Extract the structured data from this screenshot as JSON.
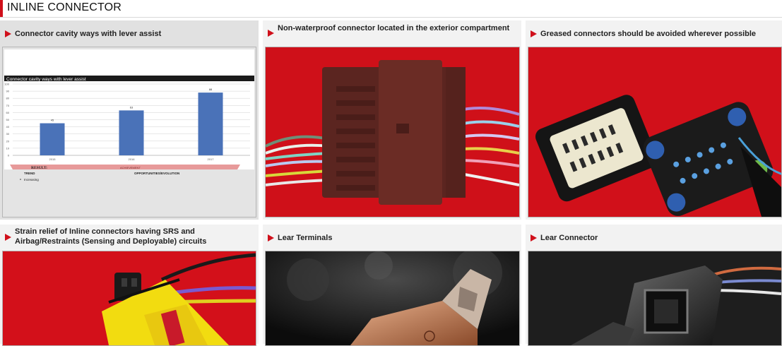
{
  "page": {
    "title": "INLINE CONNECTOR"
  },
  "cards": [
    {
      "title": "Connector cavity ways with lever assist",
      "image": "bar-chart-slide"
    },
    {
      "title": "Non-waterproof connector located in the exterior compartment",
      "image": "brown-connector-photo"
    },
    {
      "title": "Greased connectors should be avoided wherever possible",
      "image": "greased-connectors-photo"
    },
    {
      "title": "Strain relief of Inline connectors having SRS and Airbag/Restraints (Sensing and Deployable) circuits",
      "image": "yellow-connector-photo"
    },
    {
      "title": "Lear Terminals",
      "image": "terminal-photo"
    },
    {
      "title": "Lear Connector",
      "image": "black-connector-photo"
    }
  ],
  "chart_slide": {
    "banner": "Connector cavity ways with lever assist",
    "result_label": "RESULT:",
    "result_value": "ACHIEVEMENT",
    "trend_label": "TREND",
    "trend_item": "Increasing",
    "opportunities_label": "OPPORTUNITIES/EVOLUTION"
  },
  "chart_data": {
    "type": "bar",
    "title": "Connector cavity ways with lever assist",
    "categories": [
      "2015",
      "2016",
      "2017"
    ],
    "values": [
      45,
      63,
      88
    ],
    "ylim": [
      0,
      100
    ],
    "yticks": [
      0,
      10,
      20,
      30,
      40,
      50,
      60,
      70,
      80,
      90,
      100
    ],
    "grid": true,
    "colors": {
      "bar": "#4a72b8"
    }
  },
  "colors": {
    "accent": "#d0101b",
    "card_bg": "#f2f2f2",
    "photo_red": "#d3101a"
  }
}
